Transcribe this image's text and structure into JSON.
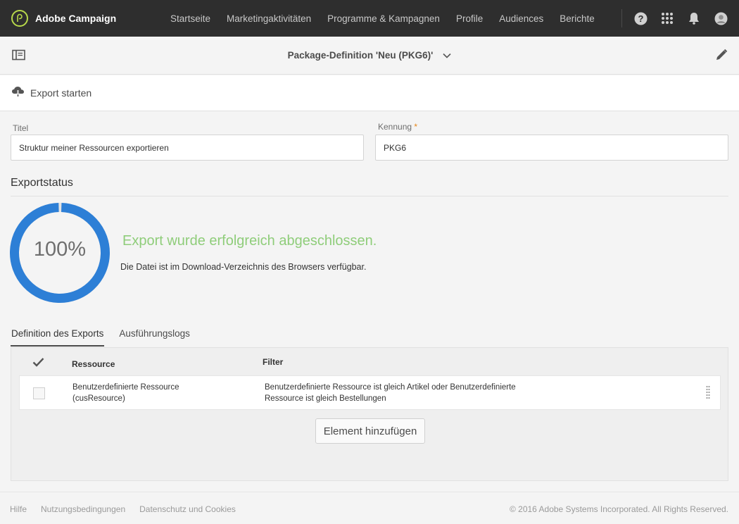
{
  "app": {
    "name": "Adobe Campaign"
  },
  "nav": {
    "items": [
      "Startseite",
      "Marketingaktivitäten",
      "Programme & Kampagnen",
      "Profile",
      "Audiences",
      "Berichte"
    ]
  },
  "header": {
    "title": "Package-Definition 'Neu (PKG6)'"
  },
  "actions": {
    "export_start": "Export starten"
  },
  "form": {
    "title_label": "Titel",
    "title_value": "Struktur meiner Ressourcen exportieren",
    "id_label": "Kennung",
    "id_required_marker": "*",
    "id_value": "PKG6"
  },
  "export_status": {
    "section_title": "Exportstatus",
    "progress_percent": 100,
    "progress_label": "100%",
    "message": "Export wurde erfolgreich abgeschlossen.",
    "sub_message": "Die Datei ist im Download-Verzeichnis des Browsers verfügbar."
  },
  "tabs": [
    {
      "label": "Definition des Exports",
      "active": true
    },
    {
      "label": "Ausführungslogs",
      "active": false
    }
  ],
  "table": {
    "columns": [
      "Ressource",
      "Filter"
    ],
    "rows": [
      {
        "resource_line1": "Benutzerdefinierte Ressource",
        "resource_line2": "(cusResource)",
        "filter_line1": "Benutzerdefinierte Ressource ist gleich Artikel oder Benutzerdefinierte",
        "filter_line2": "Ressource ist gleich Bestellungen"
      }
    ],
    "add_button": "Element hinzufügen"
  },
  "footer": {
    "links": [
      "Hilfe",
      "Nutzungsbedingungen",
      "Datenschutz und Cookies"
    ],
    "copyright": "© 2016 Adobe Systems Incorporated. All Rights Reserved."
  },
  "colors": {
    "topbar": "#2e2e2e",
    "brand_accent": "#b8d94a",
    "progress_ring": "#2d7fd6",
    "success_text": "#8fcd7a",
    "required_marker": "#e68619"
  },
  "icons": {
    "brand": "adobe-campaign-logo-icon",
    "help": "help-icon",
    "apps": "app-grid-icon",
    "notifications": "bell-icon",
    "user": "user-avatar-icon",
    "sidebar": "sidebar-toggle-icon",
    "dropdown": "chevron-down-icon",
    "edit": "pencil-icon",
    "export": "cloud-download-icon",
    "select_all": "checkmark-icon",
    "drag": "drag-handle-icon"
  }
}
